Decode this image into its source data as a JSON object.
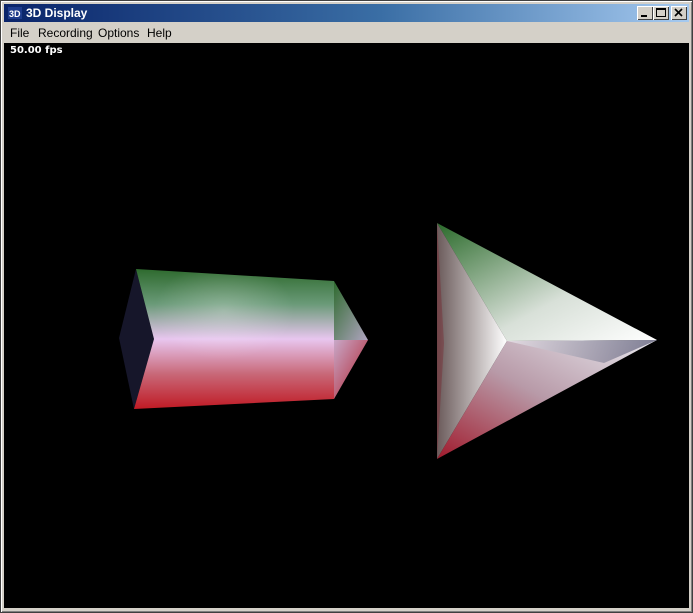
{
  "window": {
    "title": "3D Display",
    "icon": "3d-app-icon",
    "controls": [
      "minimize-icon",
      "maximize-icon",
      "close-icon"
    ]
  },
  "menu": {
    "items": [
      {
        "label": "File"
      },
      {
        "label": "Recording"
      },
      {
        "label": "Options"
      },
      {
        "label": "Help"
      }
    ]
  },
  "viewport": {
    "fps_text": "50.00 fps",
    "background": "#000000",
    "objects": [
      {
        "shape": "hexagonal-prism",
        "colors": [
          "#2f6e2f",
          "#e8c8ee",
          "#c0202a"
        ]
      },
      {
        "shape": "pyramid",
        "colors": [
          "#2f6a2f",
          "#ffffff",
          "#a01e30",
          "#4a4a6a"
        ]
      }
    ]
  },
  "colors": {
    "titlebar_start": "#0a246a",
    "titlebar_end": "#a6caf0",
    "chrome": "#d4d0c8"
  }
}
